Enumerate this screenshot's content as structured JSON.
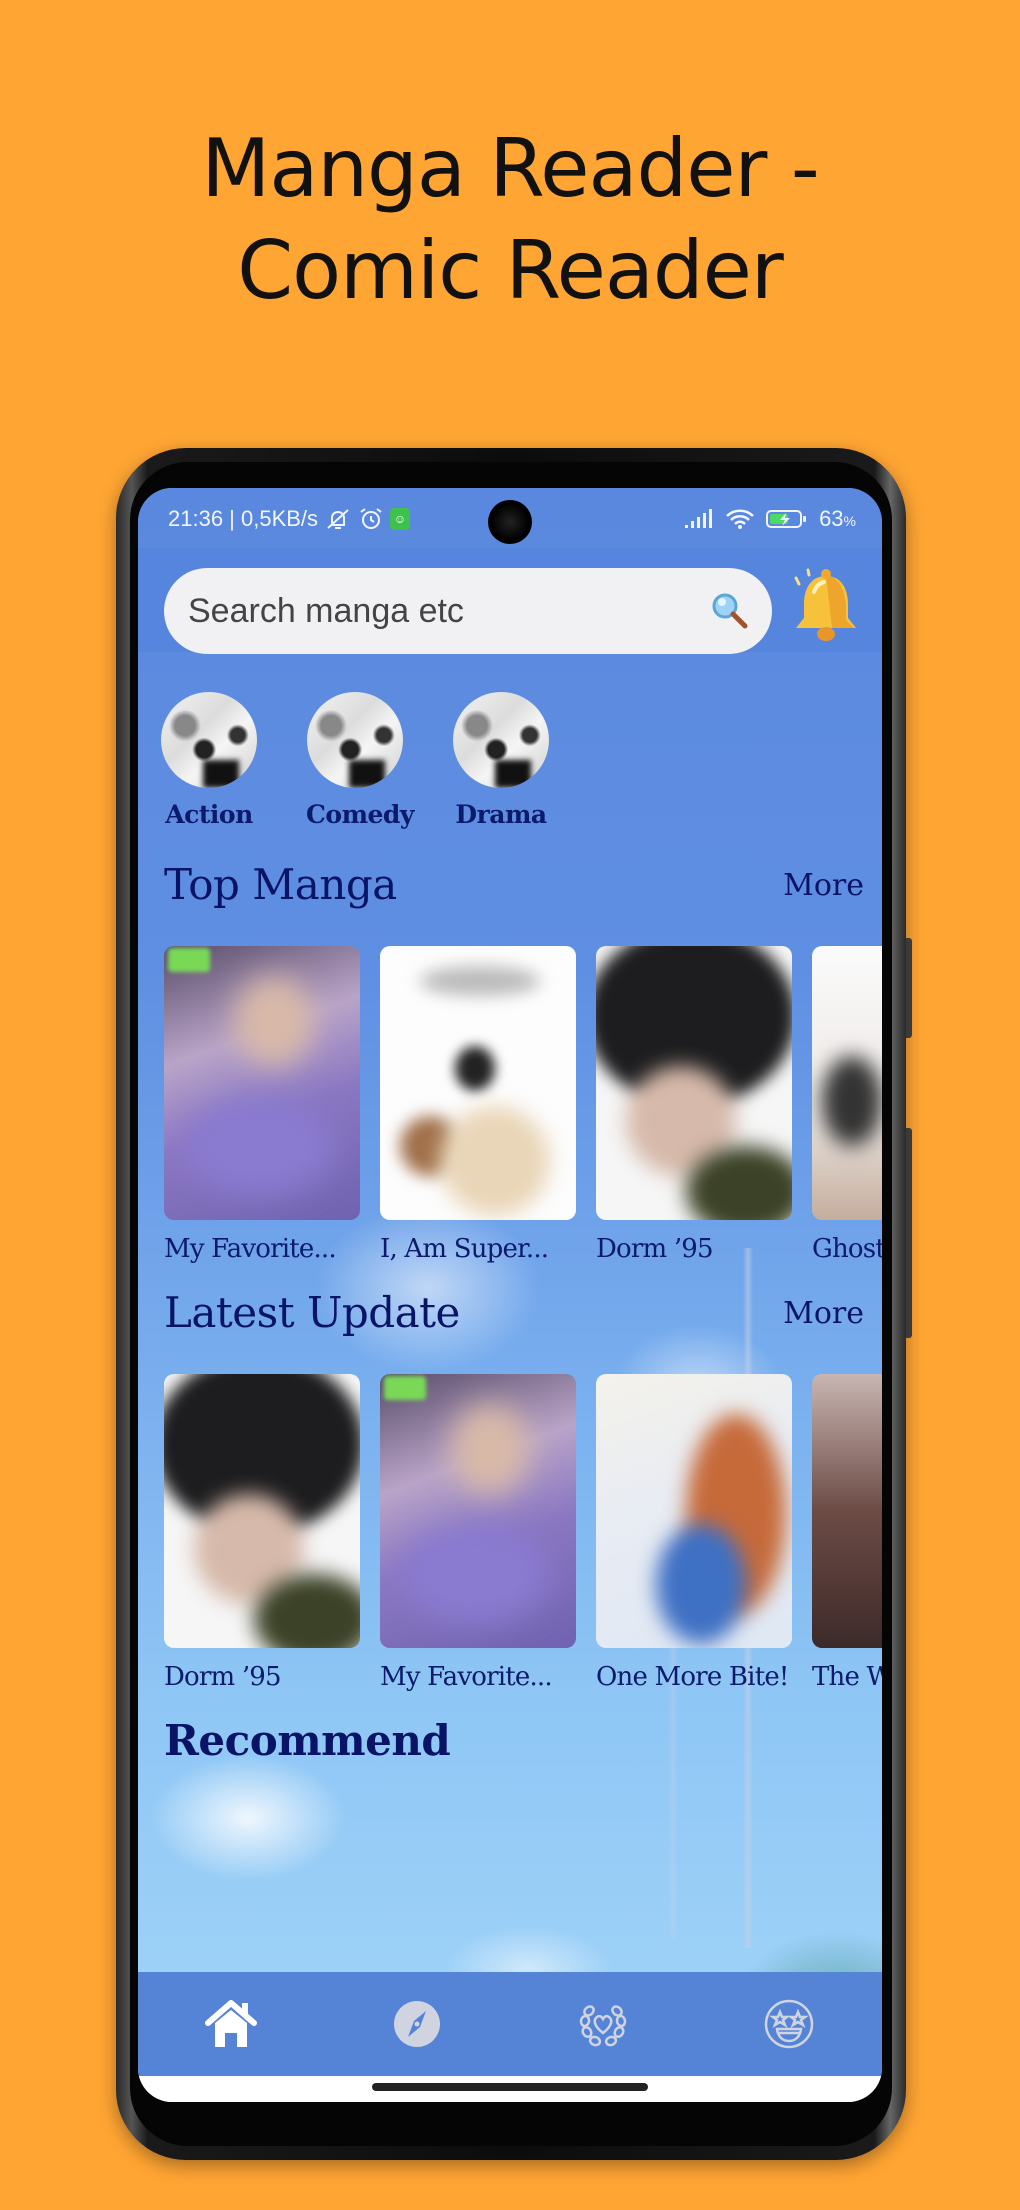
{
  "promo": {
    "title_line1": "Manga Reader -",
    "title_line2": "Comic Reader"
  },
  "statusbar": {
    "time_speed": "21:36 | 0,5KB/s",
    "battery": "63",
    "battery_unit": "%",
    "icons": [
      "notifications-muted-icon",
      "alarm-icon",
      "app-notification-icon",
      "signal-icon",
      "wifi-icon",
      "battery-charging-icon"
    ]
  },
  "header": {
    "search_placeholder": "Search manga etc",
    "search_value": "",
    "search_icon": "search-icon",
    "bell_icon": "bell-icon"
  },
  "categories": [
    {
      "label": "Action"
    },
    {
      "label": "Comedy"
    },
    {
      "label": "Drama"
    }
  ],
  "sections": {
    "top_manga": {
      "title": "Top Manga",
      "more_label": "More",
      "items": [
        {
          "title": "My Favorite..."
        },
        {
          "title": "I, Am Super..."
        },
        {
          "title": "Dorm ’95"
        },
        {
          "title": "Ghost"
        }
      ]
    },
    "latest_update": {
      "title": "Latest Update",
      "more_label": "More",
      "items": [
        {
          "title": "Dorm ’95"
        },
        {
          "title": "My Favorite..."
        },
        {
          "title": "One More Bite!"
        },
        {
          "title": "The W"
        }
      ]
    },
    "recommend": {
      "title": "Recommend"
    }
  },
  "bottom_nav": [
    {
      "name": "home",
      "icon": "home-icon",
      "active": true
    },
    {
      "name": "discover",
      "icon": "compass-icon",
      "active": false
    },
    {
      "name": "favorites",
      "icon": "heart-wreath-icon",
      "active": false
    },
    {
      "name": "profile",
      "icon": "star-eyes-face-icon",
      "active": false
    }
  ],
  "colors": {
    "background": "#FFA533",
    "app_primary": "#5585DC",
    "text_dark_blue": "#0A1466",
    "nav_active": "#FFFFFF",
    "nav_inactive": "#D0D4E0"
  }
}
